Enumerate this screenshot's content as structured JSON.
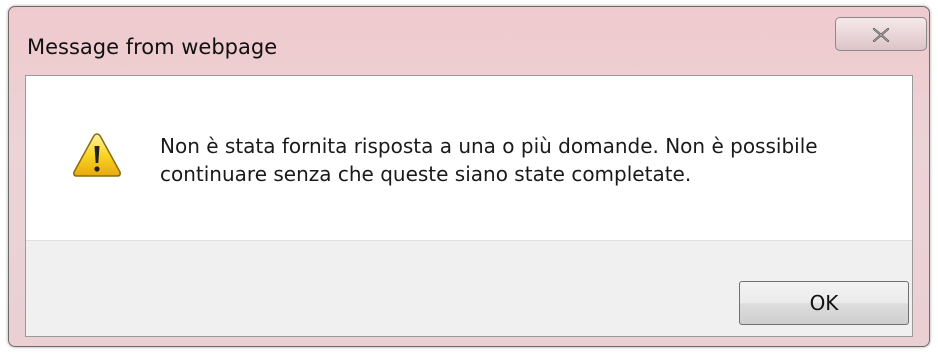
{
  "window": {
    "title": "Message from webpage",
    "close_icon": "close-icon"
  },
  "message": {
    "icon": "warning-icon",
    "line1": "Non è stata fornita risposta a una o più domande. Non è possibile",
    "line2": "continuare senza che queste siano state completate."
  },
  "buttons": {
    "ok_label": "OK"
  },
  "colors": {
    "titlebar": "#ecd0d3",
    "warning_yellow": "#f7d21b"
  }
}
